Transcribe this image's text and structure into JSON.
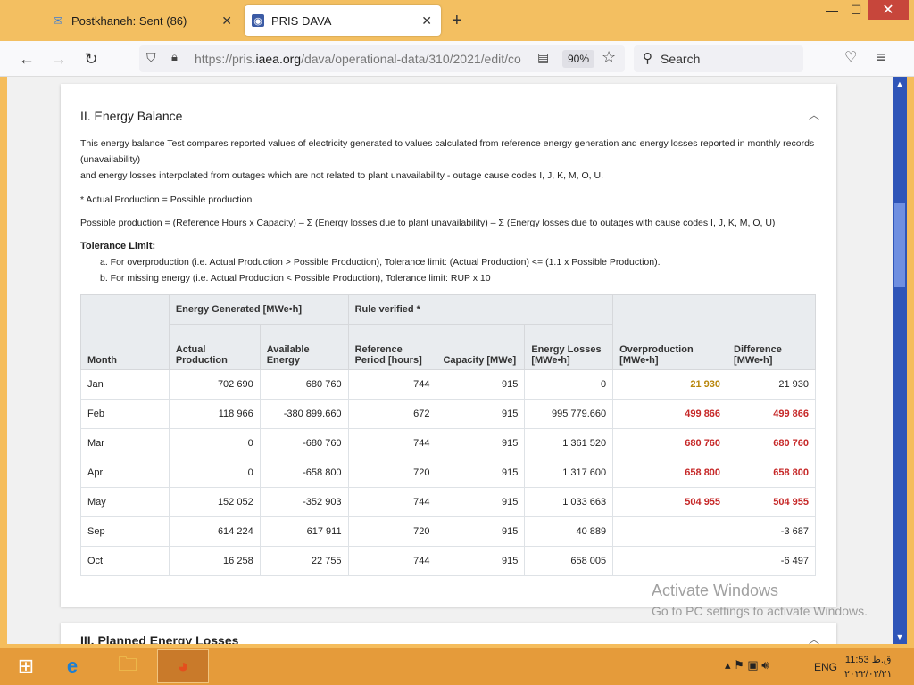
{
  "browser": {
    "tabs": [
      {
        "label": "Postkhaneh: Sent (86)",
        "icon": "mail-icon"
      },
      {
        "label": "PRIS DAVA",
        "icon": "pris-icon",
        "active": true
      }
    ],
    "url_prefix": "https://pris.",
    "url_domain": "iaea.org",
    "url_path": "/dava/operational-data/310/2021/edit/co",
    "zoom": "90%",
    "search_placeholder": "Search"
  },
  "section": {
    "title": "II. Energy Balance",
    "p1": "This energy balance Test compares reported values of electricity generated to values calculated from reference energy generation and energy losses reported in monthly records (unavailability)",
    "p2": "and energy losses interpolated from outages which are not related to plant unavailability - outage cause codes I, J, K, M, O, U.",
    "p3": "* Actual Production = Possible production",
    "p4": "Possible production = (Reference Hours x Capacity) – Σ (Energy losses due to plant unavailability) – Σ (Energy losses due to outages with cause codes I, J, K, M, O, U)",
    "tolerance_title": "Tolerance Limit:",
    "tolerance_a": "a. For overproduction (i.e. Actual Production > Possible Production), Tolerance limit: (Actual Production) <= (1.1 x Possible Production).",
    "tolerance_b": "b. For missing energy (i.e. Actual Production < Possible Production), Tolerance limit: RUP x 10"
  },
  "table": {
    "group_headers": {
      "energy": "Energy Generated [MWe•h]",
      "rule": "Rule verified *"
    },
    "headers": {
      "month": "Month",
      "actual": "Actual Production",
      "available": "Available Energy",
      "ref": "Reference Period [hours]",
      "capacity": "Capacity [MWe]",
      "losses": "Energy Losses [MWe•h]",
      "over": "Overproduction [MWe•h]",
      "diff": "Difference [MWe•h]"
    },
    "rows": [
      {
        "month": "Jan",
        "actual": "702 690",
        "available": "680 760",
        "ref": "744",
        "capacity": "915",
        "losses": "0",
        "over": "21 930",
        "diff": "21 930"
      },
      {
        "month": "Feb",
        "actual": "118 966",
        "available": "-380 899.660",
        "ref": "672",
        "capacity": "915",
        "losses": "995 779.660",
        "over": "499 866",
        "diff": "499 866"
      },
      {
        "month": "Mar",
        "actual": "0",
        "available": "-680 760",
        "ref": "744",
        "capacity": "915",
        "losses": "1 361 520",
        "over": "680 760",
        "diff": "680 760"
      },
      {
        "month": "Apr",
        "actual": "0",
        "available": "-658 800",
        "ref": "720",
        "capacity": "915",
        "losses": "1 317 600",
        "over": "658 800",
        "diff": "658 800"
      },
      {
        "month": "May",
        "actual": "152 052",
        "available": "-352 903",
        "ref": "744",
        "capacity": "915",
        "losses": "1 033 663",
        "over": "504 955",
        "diff": "504 955"
      },
      {
        "month": "Sep",
        "actual": "614 224",
        "available": "617 911",
        "ref": "720",
        "capacity": "915",
        "losses": "40 889",
        "over": "",
        "diff": "-3 687"
      },
      {
        "month": "Oct",
        "actual": "16 258",
        "available": "22 755",
        "ref": "744",
        "capacity": "915",
        "losses": "658 005",
        "over": "",
        "diff": "-6 497"
      }
    ]
  },
  "next_section": {
    "title": "III. Planned Energy Losses"
  },
  "watermark": {
    "line1": "Activate Windows",
    "line2": "Go to PC settings to activate Windows."
  },
  "taskbar": {
    "lang": "ENG",
    "time": "11:53 ق.ظ",
    "date": "۲۰۲۲/۰۲/۲۱"
  },
  "colors": {
    "red": "#c62828",
    "amber": "#b8860b",
    "accent": "#f3bf61"
  }
}
